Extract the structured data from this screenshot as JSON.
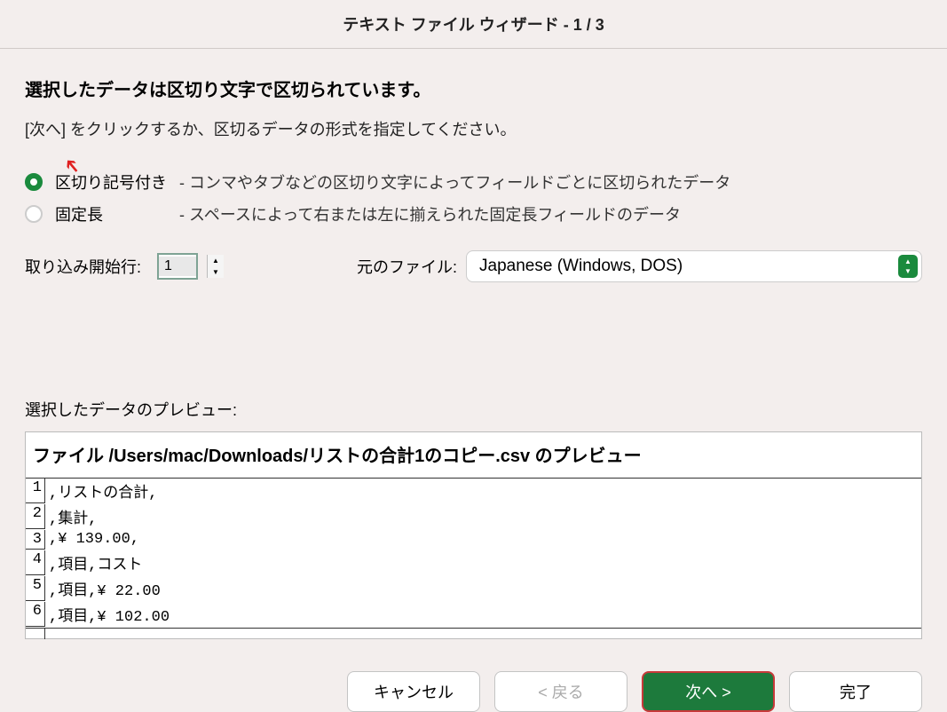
{
  "title": "テキスト ファイル ウィザード - 1 / 3",
  "heading": "選択したデータは区切り文字で区切られています。",
  "instruction": "[次へ] をクリックするか、区切るデータの形式を指定してください。",
  "radios": {
    "delimited": {
      "label": "区切り記号付き",
      "desc": "- コンマやタブなどの区切り文字によってフィールドごとに区切られたデータ"
    },
    "fixed": {
      "label": "固定長",
      "desc": "- スペースによって右または左に揃えられた固定長フィールドのデータ"
    }
  },
  "startRow": {
    "label": "取り込み開始行:",
    "value": "1"
  },
  "encoding": {
    "label": "元のファイル:",
    "value": "Japanese (Windows, DOS)"
  },
  "preview": {
    "label": "選択したデータのプレビュー:",
    "header": "ファイル /Users/mac/Downloads/リストの合計1のコピー.csv のプレビュー",
    "rows": [
      {
        "n": "1",
        "t": ",リストの合計,"
      },
      {
        "n": "2",
        "t": ",集計,"
      },
      {
        "n": "3",
        "t": ",¥ 139.00,"
      },
      {
        "n": "4",
        "t": ",項目,コスト"
      },
      {
        "n": "5",
        "t": ",項目,¥ 22.00"
      },
      {
        "n": "6",
        "t": ",項目,¥ 102.00"
      }
    ]
  },
  "buttons": {
    "cancel": "キャンセル",
    "back": "< 戻る",
    "next": "次へ >",
    "finish": "完了"
  }
}
